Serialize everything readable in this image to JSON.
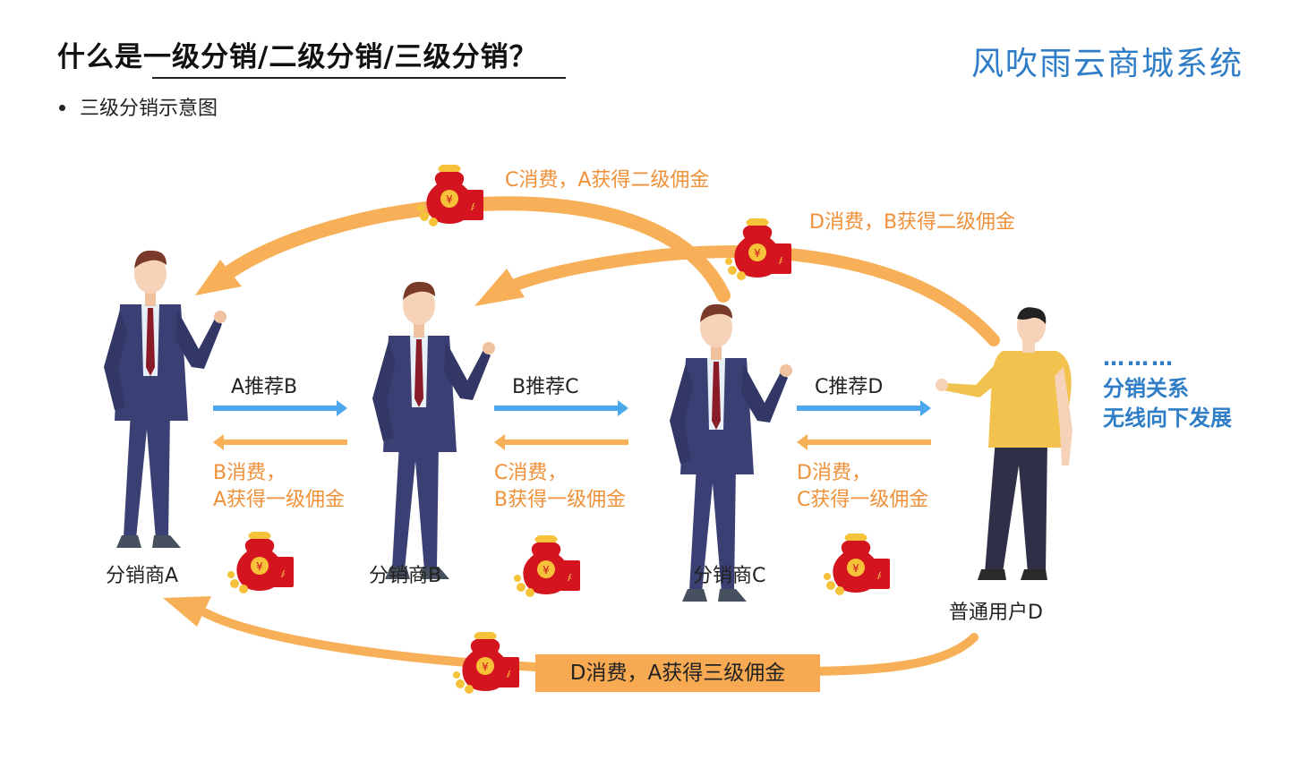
{
  "title": "什么是一级分销/二级分销/三级分销？",
  "brand": "风吹雨云商城系统",
  "bullet": "三级分销示意图",
  "nodes": {
    "a": "分销商A",
    "b": "分销商B",
    "c": "分销商C",
    "d": "普通用户D"
  },
  "recommend": {
    "ab": "A推荐B",
    "bc": "B推荐C",
    "cd": "C推荐D"
  },
  "commission_level1": {
    "ab": [
      "B消费，",
      "A获得一级佣金"
    ],
    "bc": [
      "C消费，",
      "B获得一级佣金"
    ],
    "cd": [
      "D消费，",
      "C获得一级佣金"
    ]
  },
  "commission_level2": {
    "ca": "C消费，A获得二级佣金",
    "db": "D消费，B获得二级佣金"
  },
  "commission_level3": "D消费，A获得三级佣金",
  "side_note": {
    "dots": "………",
    "line1": "分销关系",
    "line2": "无线向下发展"
  },
  "colors": {
    "orange": "#f0913a",
    "arc": "#f7b057",
    "blue_arrow": "#4ba8ec",
    "brand_blue": "#2f7dc6",
    "suit": "#3a3f74",
    "shirt_yellow": "#f2c24e"
  }
}
